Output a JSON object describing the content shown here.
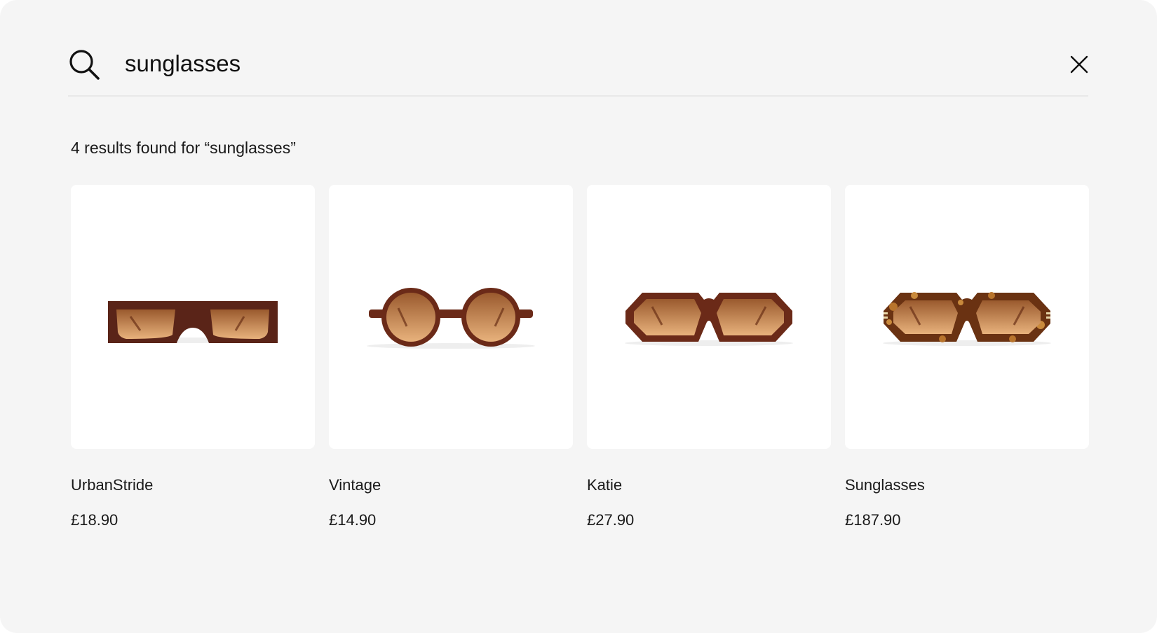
{
  "search": {
    "query": "sunglasses",
    "icon": "search-icon",
    "close_icon": "close-icon"
  },
  "results_summary": "4 results found for “sunglasses”",
  "products": [
    {
      "name": "UrbanStride",
      "price": "£18.90",
      "frame_shape": "rectangular",
      "frame_color": "#5a2418",
      "lens_color": "#c98a52"
    },
    {
      "name": "Vintage",
      "price": "£14.90",
      "frame_shape": "round",
      "frame_color": "#6b2a18",
      "lens_color": "#c98a52"
    },
    {
      "name": "Katie",
      "price": "£27.90",
      "frame_shape": "hexagonal",
      "frame_color": "#6b2a18",
      "lens_color": "#c98a52"
    },
    {
      "name": "Sunglasses",
      "price": "£187.90",
      "frame_shape": "hexagonal-tortoise",
      "frame_color": "#6a3212",
      "lens_color": "#c98a52"
    }
  ],
  "colors": {
    "background": "#f5f5f5",
    "card": "#ffffff",
    "text": "#1a1a1a",
    "divider": "#e8e8e8"
  }
}
